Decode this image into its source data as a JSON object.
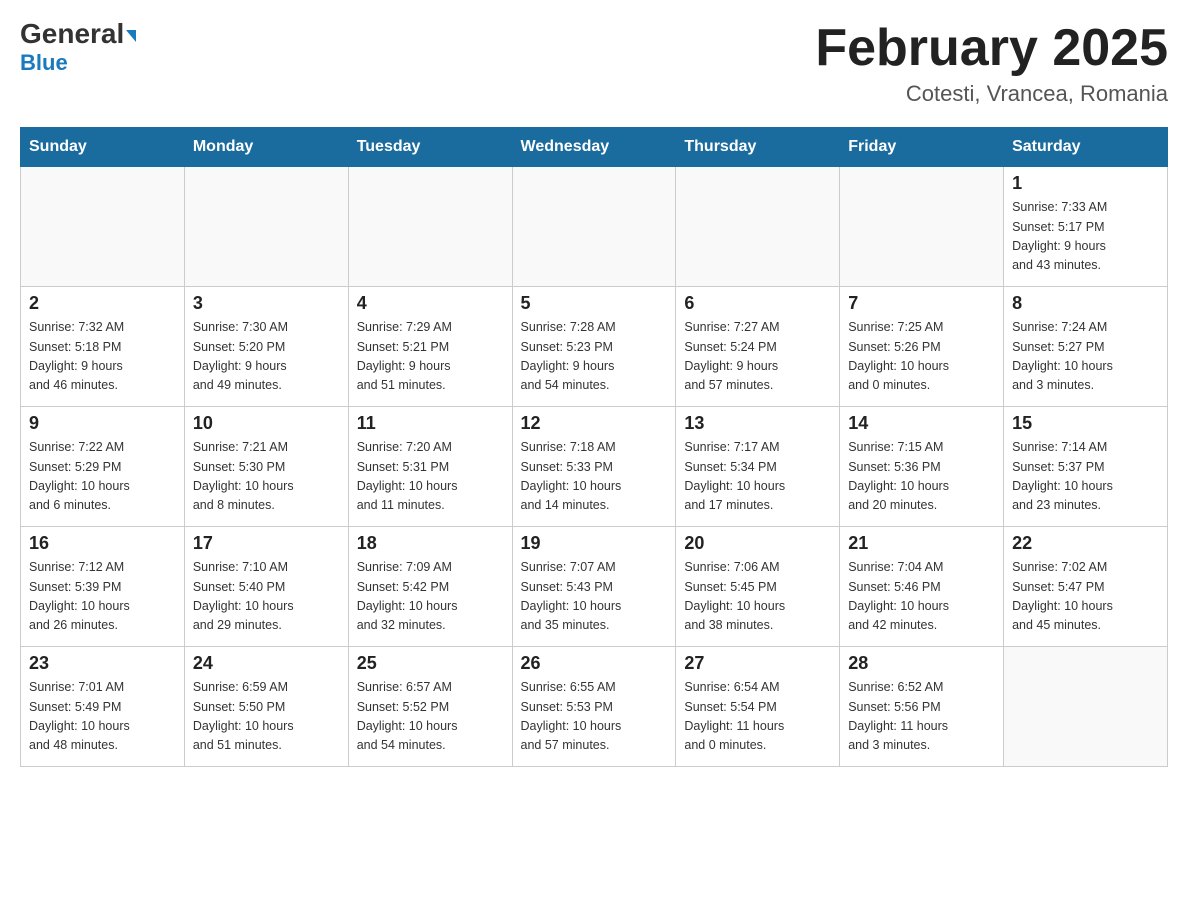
{
  "header": {
    "logo_general": "General",
    "logo_blue": "Blue",
    "title": "February 2025",
    "subtitle": "Cotesti, Vrancea, Romania"
  },
  "weekdays": [
    "Sunday",
    "Monday",
    "Tuesday",
    "Wednesday",
    "Thursday",
    "Friday",
    "Saturday"
  ],
  "weeks": [
    [
      {
        "day": "",
        "info": ""
      },
      {
        "day": "",
        "info": ""
      },
      {
        "day": "",
        "info": ""
      },
      {
        "day": "",
        "info": ""
      },
      {
        "day": "",
        "info": ""
      },
      {
        "day": "",
        "info": ""
      },
      {
        "day": "1",
        "info": "Sunrise: 7:33 AM\nSunset: 5:17 PM\nDaylight: 9 hours\nand 43 minutes."
      }
    ],
    [
      {
        "day": "2",
        "info": "Sunrise: 7:32 AM\nSunset: 5:18 PM\nDaylight: 9 hours\nand 46 minutes."
      },
      {
        "day": "3",
        "info": "Sunrise: 7:30 AM\nSunset: 5:20 PM\nDaylight: 9 hours\nand 49 minutes."
      },
      {
        "day": "4",
        "info": "Sunrise: 7:29 AM\nSunset: 5:21 PM\nDaylight: 9 hours\nand 51 minutes."
      },
      {
        "day": "5",
        "info": "Sunrise: 7:28 AM\nSunset: 5:23 PM\nDaylight: 9 hours\nand 54 minutes."
      },
      {
        "day": "6",
        "info": "Sunrise: 7:27 AM\nSunset: 5:24 PM\nDaylight: 9 hours\nand 57 minutes."
      },
      {
        "day": "7",
        "info": "Sunrise: 7:25 AM\nSunset: 5:26 PM\nDaylight: 10 hours\nand 0 minutes."
      },
      {
        "day": "8",
        "info": "Sunrise: 7:24 AM\nSunset: 5:27 PM\nDaylight: 10 hours\nand 3 minutes."
      }
    ],
    [
      {
        "day": "9",
        "info": "Sunrise: 7:22 AM\nSunset: 5:29 PM\nDaylight: 10 hours\nand 6 minutes."
      },
      {
        "day": "10",
        "info": "Sunrise: 7:21 AM\nSunset: 5:30 PM\nDaylight: 10 hours\nand 8 minutes."
      },
      {
        "day": "11",
        "info": "Sunrise: 7:20 AM\nSunset: 5:31 PM\nDaylight: 10 hours\nand 11 minutes."
      },
      {
        "day": "12",
        "info": "Sunrise: 7:18 AM\nSunset: 5:33 PM\nDaylight: 10 hours\nand 14 minutes."
      },
      {
        "day": "13",
        "info": "Sunrise: 7:17 AM\nSunset: 5:34 PM\nDaylight: 10 hours\nand 17 minutes."
      },
      {
        "day": "14",
        "info": "Sunrise: 7:15 AM\nSunset: 5:36 PM\nDaylight: 10 hours\nand 20 minutes."
      },
      {
        "day": "15",
        "info": "Sunrise: 7:14 AM\nSunset: 5:37 PM\nDaylight: 10 hours\nand 23 minutes."
      }
    ],
    [
      {
        "day": "16",
        "info": "Sunrise: 7:12 AM\nSunset: 5:39 PM\nDaylight: 10 hours\nand 26 minutes."
      },
      {
        "day": "17",
        "info": "Sunrise: 7:10 AM\nSunset: 5:40 PM\nDaylight: 10 hours\nand 29 minutes."
      },
      {
        "day": "18",
        "info": "Sunrise: 7:09 AM\nSunset: 5:42 PM\nDaylight: 10 hours\nand 32 minutes."
      },
      {
        "day": "19",
        "info": "Sunrise: 7:07 AM\nSunset: 5:43 PM\nDaylight: 10 hours\nand 35 minutes."
      },
      {
        "day": "20",
        "info": "Sunrise: 7:06 AM\nSunset: 5:45 PM\nDaylight: 10 hours\nand 38 minutes."
      },
      {
        "day": "21",
        "info": "Sunrise: 7:04 AM\nSunset: 5:46 PM\nDaylight: 10 hours\nand 42 minutes."
      },
      {
        "day": "22",
        "info": "Sunrise: 7:02 AM\nSunset: 5:47 PM\nDaylight: 10 hours\nand 45 minutes."
      }
    ],
    [
      {
        "day": "23",
        "info": "Sunrise: 7:01 AM\nSunset: 5:49 PM\nDaylight: 10 hours\nand 48 minutes."
      },
      {
        "day": "24",
        "info": "Sunrise: 6:59 AM\nSunset: 5:50 PM\nDaylight: 10 hours\nand 51 minutes."
      },
      {
        "day": "25",
        "info": "Sunrise: 6:57 AM\nSunset: 5:52 PM\nDaylight: 10 hours\nand 54 minutes."
      },
      {
        "day": "26",
        "info": "Sunrise: 6:55 AM\nSunset: 5:53 PM\nDaylight: 10 hours\nand 57 minutes."
      },
      {
        "day": "27",
        "info": "Sunrise: 6:54 AM\nSunset: 5:54 PM\nDaylight: 11 hours\nand 0 minutes."
      },
      {
        "day": "28",
        "info": "Sunrise: 6:52 AM\nSunset: 5:56 PM\nDaylight: 11 hours\nand 3 minutes."
      },
      {
        "day": "",
        "info": ""
      }
    ]
  ]
}
